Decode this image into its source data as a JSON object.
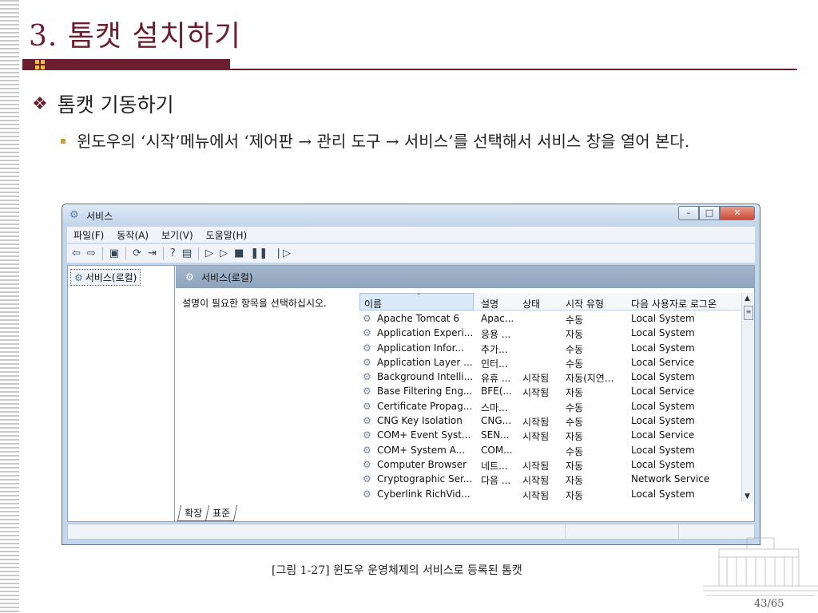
{
  "slide": {
    "title": "3. 톰캣 설치하기",
    "bullet1": "톰캣 기동하기",
    "bullet2": "윈도우의 ‘시작’메뉴에서 ‘제어판 → 관리 도구 → 서비스’를 선택해서 서비스 창을 열어 본다.",
    "caption": "[그림 1-27] 윈도우 운영체제의 서비스로 등록된 톰캣",
    "page_number": "43/65"
  },
  "window": {
    "title": "서비스",
    "menu": [
      "파일(F)",
      "동작(A)",
      "보기(V)",
      "도움말(H)"
    ],
    "tree_item": "서비스(로컬)",
    "pane_header": "서비스(로컬)",
    "description_prompt": "설명이 필요한 항목을 선택하십시오.",
    "columns": [
      "이름",
      "설명",
      "상태",
      "시작 유형",
      "다음 사용자로 로그온"
    ],
    "rows": [
      {
        "name": "Apache Tomcat 6",
        "desc": "Apac...",
        "status": "",
        "startup": "수동",
        "logon": "Local System"
      },
      {
        "name": "Application Experi...",
        "desc": "응용 ...",
        "status": "",
        "startup": "자동",
        "logon": "Local System"
      },
      {
        "name": "Application Infor...",
        "desc": "추가...",
        "status": "",
        "startup": "수동",
        "logon": "Local System"
      },
      {
        "name": "Application Layer ...",
        "desc": "인터...",
        "status": "",
        "startup": "수동",
        "logon": "Local Service"
      },
      {
        "name": "Background Intelli...",
        "desc": "유휴 ...",
        "status": "시작됨",
        "startup": "자동(지연...",
        "logon": "Local System"
      },
      {
        "name": "Base Filtering Eng...",
        "desc": "BFE(...",
        "status": "시작됨",
        "startup": "자동",
        "logon": "Local Service"
      },
      {
        "name": "Certificate Propag...",
        "desc": "스마...",
        "status": "",
        "startup": "수동",
        "logon": "Local System"
      },
      {
        "name": "CNG Key Isolation",
        "desc": "CNG...",
        "status": "시작됨",
        "startup": "수동",
        "logon": "Local System"
      },
      {
        "name": "COM+ Event Syst...",
        "desc": "SEN...",
        "status": "시작됨",
        "startup": "자동",
        "logon": "Local Service"
      },
      {
        "name": "COM+ System A...",
        "desc": "COM...",
        "status": "",
        "startup": "수동",
        "logon": "Local System"
      },
      {
        "name": "Computer Browser",
        "desc": "네트...",
        "status": "시작됨",
        "startup": "자동",
        "logon": "Local System"
      },
      {
        "name": "Cryptographic Ser...",
        "desc": "다음 ...",
        "status": "시작됨",
        "startup": "자동",
        "logon": "Network Service"
      },
      {
        "name": "Cyberlink RichVid...",
        "desc": "",
        "status": "시작됨",
        "startup": "자동",
        "logon": "Local System"
      }
    ],
    "tabs": [
      "확장",
      "표준"
    ]
  },
  "colors": {
    "accent": "#6b1f2e",
    "window_chrome": "#c2d6ec",
    "pane_header": "#9aaec4"
  }
}
